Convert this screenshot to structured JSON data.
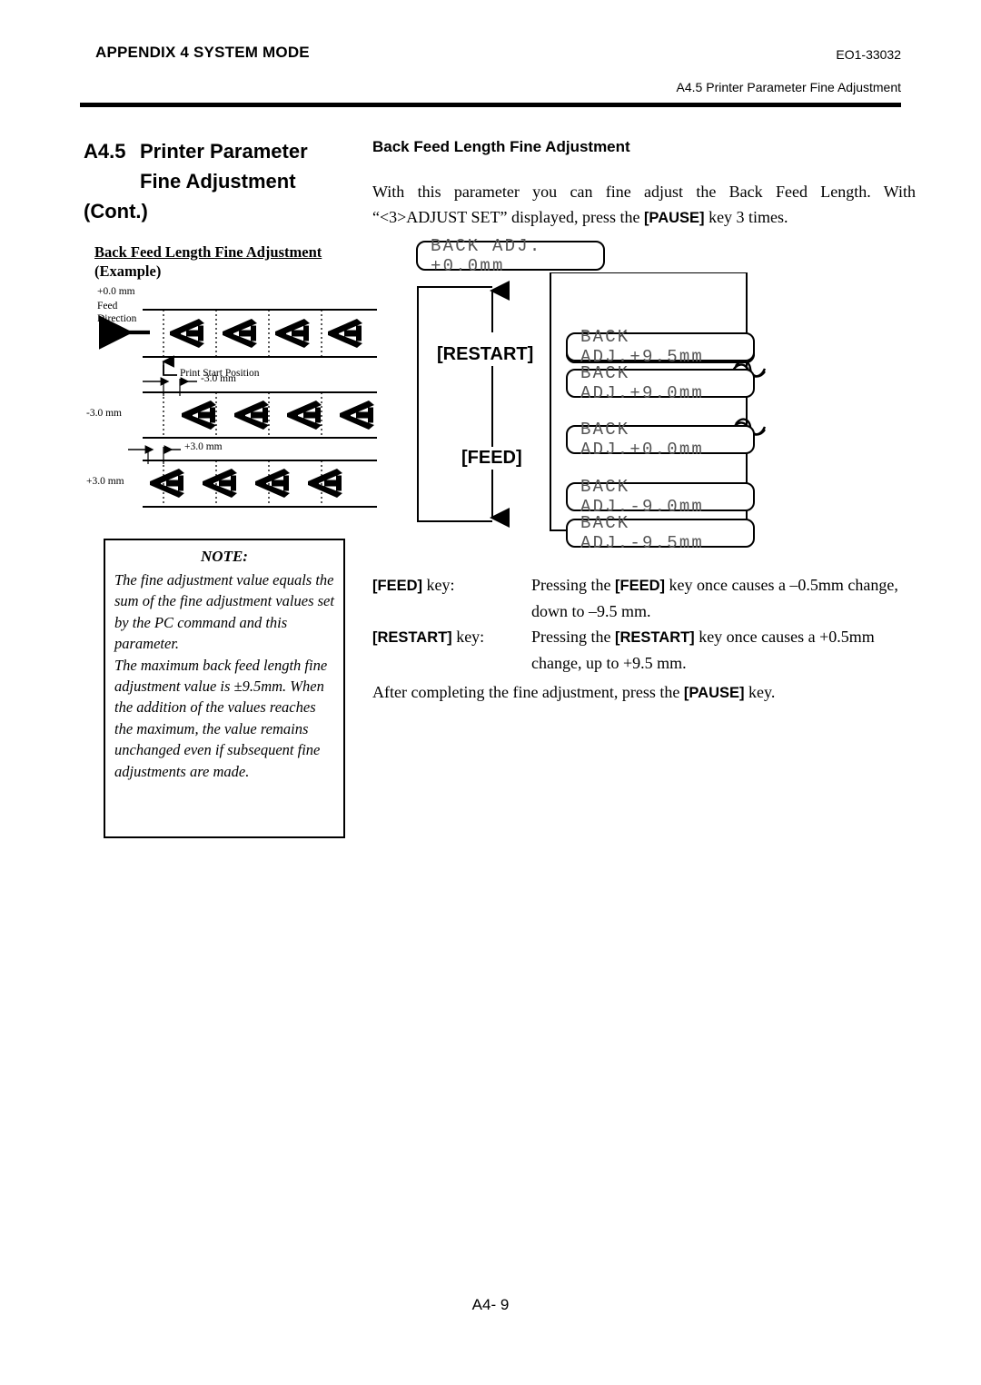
{
  "header": {
    "left_title": "APPENDIX 4 SYSTEM MODE",
    "doc_code": "EO1-33032",
    "section_ref": "A4.5 Printer Parameter Fine Adjustment"
  },
  "left_column": {
    "section_number": "A4.5",
    "section_title_line1": "Printer Parameter",
    "section_title_line2": "Fine Adjustment",
    "section_title_line3": "(Cont.)",
    "example_title": "Back Feed Length Fine Adjustment",
    "example_subtitle": "(Example)",
    "diagram": {
      "label_zero": "+0.0 mm",
      "label_feed": "Feed",
      "label_direction": "Direction",
      "label_print_start": "Print Start Position",
      "label_minus_dim": "-3.0 mm",
      "label_minus_row": "-3.0 mm",
      "label_plus_dim": "+3.0 mm",
      "label_plus_row": "+3.0 mm",
      "glyph": "A"
    },
    "note": {
      "heading": "NOTE:",
      "paragraph1": "The fine adjustment value equals the sum of the fine adjustment values set by the PC command and this parameter.",
      "paragraph2": "The maximum back feed length fine adjustment value is ±9.5mm. When the addition of the values reaches the maximum, the value remains unchanged even if subsequent fine adjustments are made."
    }
  },
  "right_column": {
    "heading": "Back Feed Length Fine Adjustment",
    "intro_text_1": "With this parameter you can fine adjust the Back Feed Length.  With “<3>ADJUST SET” displayed, press the ",
    "intro_key": "[PAUSE]",
    "intro_text_2": " key 3 times.",
    "flow": {
      "current_display": "BACK ADJ. +0.0mm",
      "restart_label": "[RESTART]",
      "feed_label": "[FEED]",
      "steps": [
        "BACK ADJ.+9.5mm",
        "BACK ADJ.+9.0mm",
        "BACK ADJ.+0.0mm",
        "BACK ADJ.-9.0mm",
        "BACK ADJ.-9.5mm"
      ]
    },
    "key_rows": [
      {
        "name": "[FEED]",
        "name_suffix": " key:",
        "desc_pre": "Pressing the ",
        "desc_key": "[FEED]",
        "desc_post": " key once causes a –0.5mm change, down to –9.5 mm."
      },
      {
        "name": "[RESTART]",
        "name_suffix": " key:",
        "desc_pre": "Pressing the ",
        "desc_key": "[RESTART]",
        "desc_post": " key once causes a +0.5mm change, up to +9.5 mm."
      }
    ],
    "closing_pre": "After completing the fine adjustment, press the ",
    "closing_key": "[PAUSE]",
    "closing_post": " key."
  },
  "footer": {
    "page_number": "A4- 9"
  }
}
